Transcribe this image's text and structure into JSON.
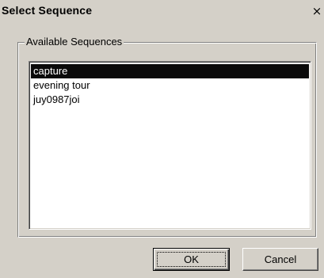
{
  "window": {
    "title": "Select Sequence",
    "close_glyph": "×"
  },
  "group": {
    "label": "Available Sequences"
  },
  "sequences": [
    {
      "label": "capture",
      "selected": true
    },
    {
      "label": "evening tour",
      "selected": false
    },
    {
      "label": "juy0987joi",
      "selected": false
    }
  ],
  "buttons": {
    "ok_label": "OK",
    "cancel_label": "Cancel"
  },
  "colors": {
    "face": "#d4d0c8",
    "selection": "#0a0a0a",
    "list_bg": "#ffffff"
  }
}
